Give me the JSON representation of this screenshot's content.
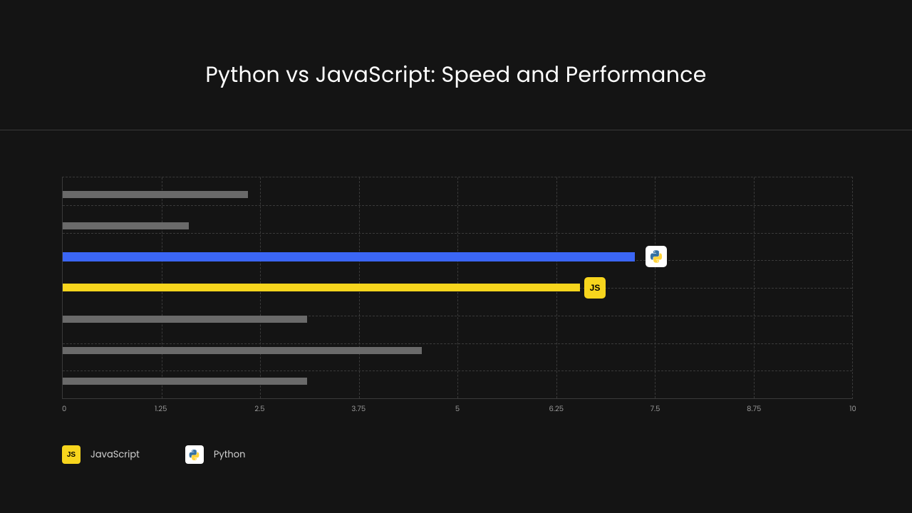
{
  "title": "Python vs JavaScript: Speed and Performance",
  "legend": {
    "js": "JavaScript",
    "py": "Python"
  },
  "xticks": [
    "0",
    "1.25",
    "2.5",
    "3.75",
    "5",
    "6.25",
    "7.5",
    "10",
    "8.75"
  ],
  "chart_data": {
    "type": "bar",
    "orientation": "horizontal",
    "title": "Python vs JavaScript: Speed and Performance",
    "xlabel": "",
    "ylabel": "",
    "xlim": [
      0,
      10
    ],
    "xticks": [
      0,
      1.25,
      2.5,
      3.75,
      5,
      6.25,
      7.5,
      8.75,
      10
    ],
    "grid": true,
    "legend_entries": [
      "JavaScript",
      "Python"
    ],
    "bars": [
      {
        "row": 0,
        "value": 2.35,
        "color": "gray",
        "label": ""
      },
      {
        "row": 1,
        "value": 1.6,
        "color": "gray",
        "label": ""
      },
      {
        "row": 2,
        "value": 7.25,
        "color": "blue",
        "label": "Python"
      },
      {
        "row": 3,
        "value": 6.55,
        "color": "yellow",
        "label": "JavaScript"
      },
      {
        "row": 4,
        "value": 3.1,
        "color": "gray",
        "label": ""
      },
      {
        "row": 5,
        "value": 4.55,
        "color": "gray",
        "label": ""
      },
      {
        "row": 6,
        "value": 3.1,
        "color": "gray",
        "label": ""
      }
    ]
  }
}
